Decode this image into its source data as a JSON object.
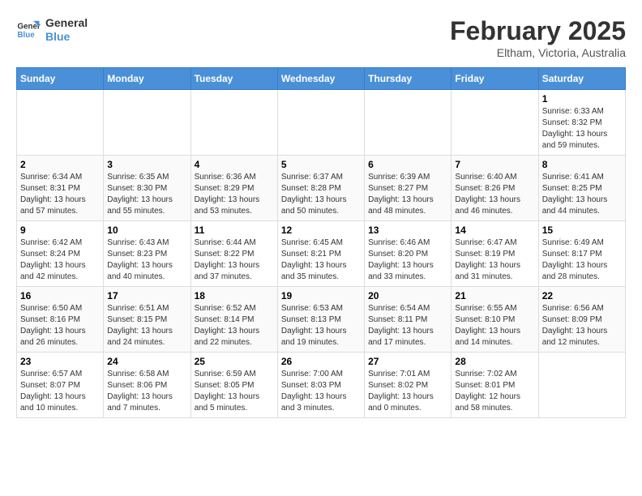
{
  "logo": {
    "text_general": "General",
    "text_blue": "Blue"
  },
  "header": {
    "month_year": "February 2025",
    "location": "Eltham, Victoria, Australia"
  },
  "days_of_week": [
    "Sunday",
    "Monday",
    "Tuesday",
    "Wednesday",
    "Thursday",
    "Friday",
    "Saturday"
  ],
  "weeks": [
    [
      {
        "day": "",
        "info": ""
      },
      {
        "day": "",
        "info": ""
      },
      {
        "day": "",
        "info": ""
      },
      {
        "day": "",
        "info": ""
      },
      {
        "day": "",
        "info": ""
      },
      {
        "day": "",
        "info": ""
      },
      {
        "day": "1",
        "info": "Sunrise: 6:33 AM\nSunset: 8:32 PM\nDaylight: 13 hours\nand 59 minutes."
      }
    ],
    [
      {
        "day": "2",
        "info": "Sunrise: 6:34 AM\nSunset: 8:31 PM\nDaylight: 13 hours\nand 57 minutes."
      },
      {
        "day": "3",
        "info": "Sunrise: 6:35 AM\nSunset: 8:30 PM\nDaylight: 13 hours\nand 55 minutes."
      },
      {
        "day": "4",
        "info": "Sunrise: 6:36 AM\nSunset: 8:29 PM\nDaylight: 13 hours\nand 53 minutes."
      },
      {
        "day": "5",
        "info": "Sunrise: 6:37 AM\nSunset: 8:28 PM\nDaylight: 13 hours\nand 50 minutes."
      },
      {
        "day": "6",
        "info": "Sunrise: 6:39 AM\nSunset: 8:27 PM\nDaylight: 13 hours\nand 48 minutes."
      },
      {
        "day": "7",
        "info": "Sunrise: 6:40 AM\nSunset: 8:26 PM\nDaylight: 13 hours\nand 46 minutes."
      },
      {
        "day": "8",
        "info": "Sunrise: 6:41 AM\nSunset: 8:25 PM\nDaylight: 13 hours\nand 44 minutes."
      }
    ],
    [
      {
        "day": "9",
        "info": "Sunrise: 6:42 AM\nSunset: 8:24 PM\nDaylight: 13 hours\nand 42 minutes."
      },
      {
        "day": "10",
        "info": "Sunrise: 6:43 AM\nSunset: 8:23 PM\nDaylight: 13 hours\nand 40 minutes."
      },
      {
        "day": "11",
        "info": "Sunrise: 6:44 AM\nSunset: 8:22 PM\nDaylight: 13 hours\nand 37 minutes."
      },
      {
        "day": "12",
        "info": "Sunrise: 6:45 AM\nSunset: 8:21 PM\nDaylight: 13 hours\nand 35 minutes."
      },
      {
        "day": "13",
        "info": "Sunrise: 6:46 AM\nSunset: 8:20 PM\nDaylight: 13 hours\nand 33 minutes."
      },
      {
        "day": "14",
        "info": "Sunrise: 6:47 AM\nSunset: 8:19 PM\nDaylight: 13 hours\nand 31 minutes."
      },
      {
        "day": "15",
        "info": "Sunrise: 6:49 AM\nSunset: 8:17 PM\nDaylight: 13 hours\nand 28 minutes."
      }
    ],
    [
      {
        "day": "16",
        "info": "Sunrise: 6:50 AM\nSunset: 8:16 PM\nDaylight: 13 hours\nand 26 minutes."
      },
      {
        "day": "17",
        "info": "Sunrise: 6:51 AM\nSunset: 8:15 PM\nDaylight: 13 hours\nand 24 minutes."
      },
      {
        "day": "18",
        "info": "Sunrise: 6:52 AM\nSunset: 8:14 PM\nDaylight: 13 hours\nand 22 minutes."
      },
      {
        "day": "19",
        "info": "Sunrise: 6:53 AM\nSunset: 8:13 PM\nDaylight: 13 hours\nand 19 minutes."
      },
      {
        "day": "20",
        "info": "Sunrise: 6:54 AM\nSunset: 8:11 PM\nDaylight: 13 hours\nand 17 minutes."
      },
      {
        "day": "21",
        "info": "Sunrise: 6:55 AM\nSunset: 8:10 PM\nDaylight: 13 hours\nand 14 minutes."
      },
      {
        "day": "22",
        "info": "Sunrise: 6:56 AM\nSunset: 8:09 PM\nDaylight: 13 hours\nand 12 minutes."
      }
    ],
    [
      {
        "day": "23",
        "info": "Sunrise: 6:57 AM\nSunset: 8:07 PM\nDaylight: 13 hours\nand 10 minutes."
      },
      {
        "day": "24",
        "info": "Sunrise: 6:58 AM\nSunset: 8:06 PM\nDaylight: 13 hours\nand 7 minutes."
      },
      {
        "day": "25",
        "info": "Sunrise: 6:59 AM\nSunset: 8:05 PM\nDaylight: 13 hours\nand 5 minutes."
      },
      {
        "day": "26",
        "info": "Sunrise: 7:00 AM\nSunset: 8:03 PM\nDaylight: 13 hours\nand 3 minutes."
      },
      {
        "day": "27",
        "info": "Sunrise: 7:01 AM\nSunset: 8:02 PM\nDaylight: 13 hours\nand 0 minutes."
      },
      {
        "day": "28",
        "info": "Sunrise: 7:02 AM\nSunset: 8:01 PM\nDaylight: 12 hours\nand 58 minutes."
      },
      {
        "day": "",
        "info": ""
      }
    ]
  ]
}
